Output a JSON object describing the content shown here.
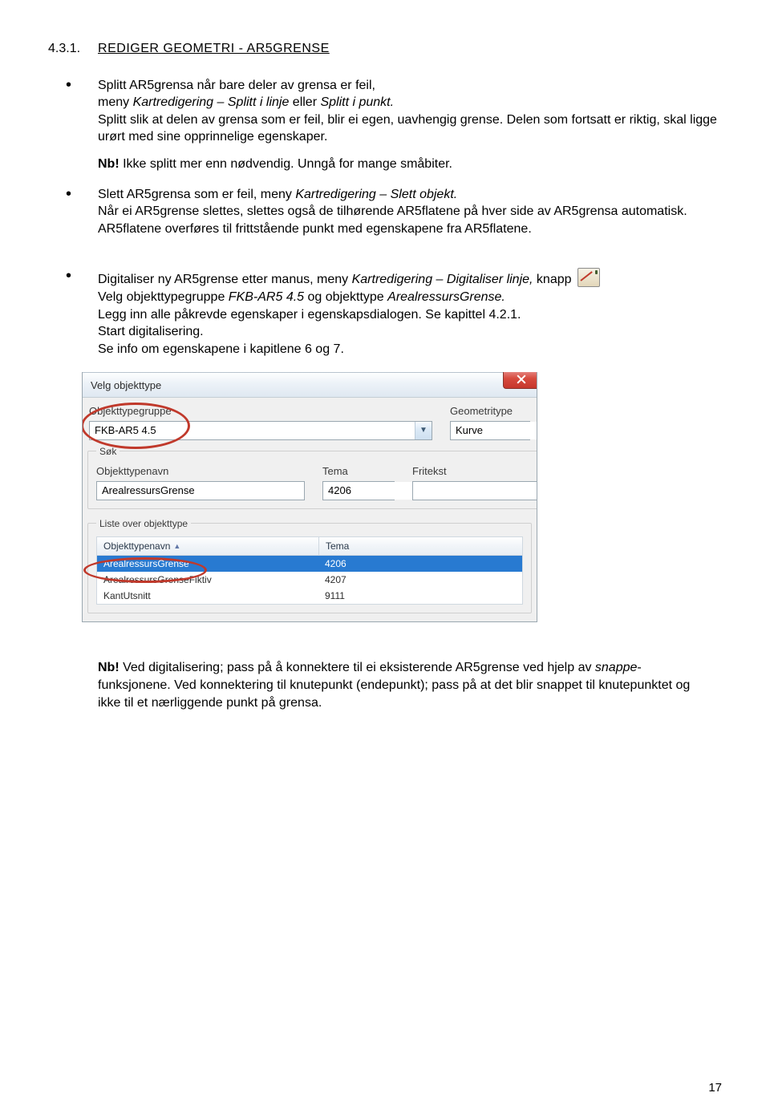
{
  "heading": {
    "number": "4.3.1.",
    "title": "REDIGER GEOMETRI - AR5GRENSE"
  },
  "bullets": {
    "b1": {
      "line1": "Splitt AR5grensa når bare deler av grensa er feil,",
      "line2_a": "meny ",
      "line2_b": "Kartredigering – Splitt i linje",
      "line2_c": " eller ",
      "line2_d": "Splitt i punkt.",
      "line3": "Splitt slik at delen av grensa som er feil, blir ei egen, uavhengig grense. Delen som fortsatt er riktig, skal ligge urørt med sine opprinnelige egenskaper.",
      "nb_a": "Nb!",
      "nb_b": " Ikke splitt mer enn nødvendig. Unngå for mange småbiter."
    },
    "b2": {
      "line1_a": "Slett AR5grensa som er feil, meny ",
      "line1_b": "Kartredigering – Slett objekt.",
      "line2": "Når ei AR5grense slettes, slettes også de tilhørende AR5flatene på hver side av AR5grensa automatisk. AR5flatene overføres til frittstående punkt med egenskapene fra AR5flatene."
    },
    "b3": {
      "line1_a": "Digitaliser ny AR5grense etter manus, meny ",
      "line1_b": "Kartredigering – Digitaliser linje,",
      "line1_c": " knapp",
      "line2_a": "Velg objekttypegruppe ",
      "line2_b": "FKB-AR5 4.5",
      "line2_c": " og objekttype ",
      "line2_d": "ArealressursGrense.",
      "line3": "Legg inn alle påkrevde egenskaper i egenskapsdialogen. Se kapittel 4.2.1.",
      "line4": "Start digitalisering.",
      "line5": "Se info om egenskapene i kapitlene 6 og 7."
    }
  },
  "dialog": {
    "title": "Velg objekttype",
    "close_icon": "close-icon",
    "group_label": "Objekttypegruppe",
    "group_value": "FKB-AR5 4.5",
    "geomtype_label": "Geometritype",
    "geomtype_value": "Kurve",
    "sok_legend": "Søk",
    "sok_name_label": "Objekttypenavn",
    "sok_name_value": "ArealressursGrense",
    "sok_tema_label": "Tema",
    "sok_tema_value": "4206",
    "sok_fritekst_label": "Fritekst",
    "sok_fritekst_value": "",
    "list_legend": "Liste over objekttype",
    "list_col1": "Objekttypenavn",
    "list_col2": "Tema",
    "rows": [
      {
        "name": "ArealressursGrense",
        "tema": "4206"
      },
      {
        "name": "ArealressursGrenseFiktiv",
        "tema": "4207"
      },
      {
        "name": "KantUtsnitt",
        "tema": "9111"
      }
    ]
  },
  "bottom": {
    "nb_a": "Nb!",
    "nb_b": " Ved digitalisering; pass på å konnektere til ei eksisterende AR5grense ved hjelp av ",
    "snappe": "snappe",
    "nb_c": "-funksjonene. Ved konnektering til knutepunkt (endepunkt); pass på at det blir snappet til knutepunktet og ikke til et nærliggende punkt på grensa."
  },
  "page_number": "17"
}
